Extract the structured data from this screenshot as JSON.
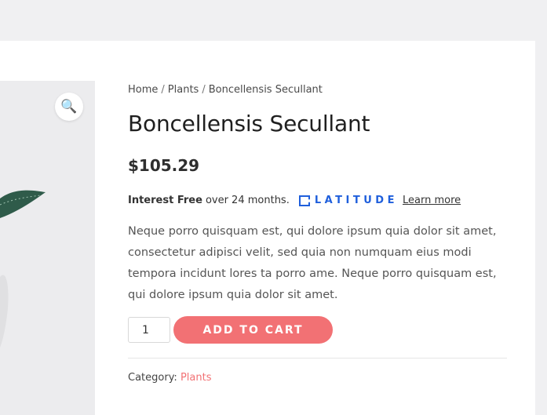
{
  "breadcrumb": {
    "items": [
      "Home",
      "Plants",
      "Boncellensis Secullant"
    ],
    "separator": "/"
  },
  "product": {
    "title": "Boncellensis Secullant",
    "price": "$105.29",
    "description": "Neque porro quisquam est, qui dolore ipsum quia dolor sit amet, consectetur adipisci velit, sed quia non numquam eius modi tempora incidunt lores ta porro ame. Neque porro quisquam est, qui dolore ipsum quia dolor sit amet.",
    "quantity": "1",
    "add_to_cart_label": "ADD TO CART",
    "category_label": "Category:",
    "category_value": "Plants"
  },
  "latitude": {
    "interest_free": "Interest Free",
    "months_text": "over 24 months.",
    "brand": "LATITUDE",
    "learn_more": "Learn more"
  },
  "gallery": {
    "zoom_icon": "search-icon"
  },
  "colors": {
    "accent": "#f27174",
    "latitude_blue": "#1f5fdc",
    "page_bg": "#f0f0f2",
    "gallery_bg": "#ececee"
  }
}
